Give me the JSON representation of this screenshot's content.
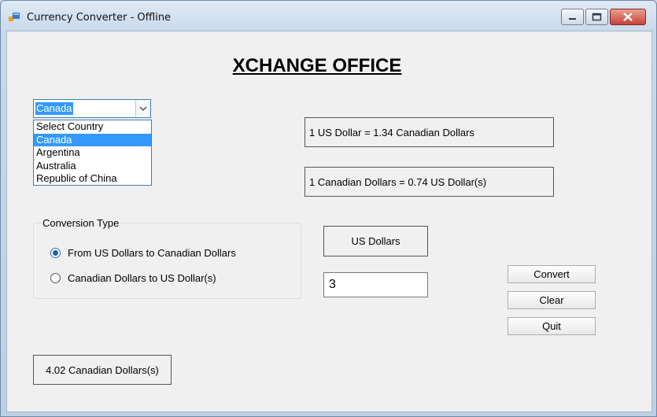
{
  "window": {
    "title": "Currency Converter - Offline",
    "icon": "app-window-icon"
  },
  "heading": "XCHANGE OFFICE",
  "country_select": {
    "value": "Canada",
    "options": [
      "Select Country",
      "Canada",
      "Argentina",
      "Australia",
      "Republic of China"
    ],
    "selected_option": "Canada"
  },
  "rates": {
    "forward": "1 US Dollar = 1.34 Canadian Dollars",
    "reverse": "1 Canadian Dollars = 0.74 US Dollar(s)"
  },
  "conversion_type": {
    "label": "Conversion Type",
    "options": [
      {
        "label": "From US Dollars to Canadian Dollars",
        "checked": true
      },
      {
        "label": "Canadian Dollars to US Dollar(s)",
        "checked": false
      }
    ]
  },
  "input": {
    "unit_label": "US Dollars",
    "amount": "3"
  },
  "buttons": {
    "convert": "Convert",
    "clear": "Clear",
    "quit": "Quit"
  },
  "result": "4.02 Canadian Dollars(s)",
  "colors": {
    "selection": "#3399ff",
    "radio_accent": "#1e5fad",
    "close_button": "#c7443a"
  }
}
